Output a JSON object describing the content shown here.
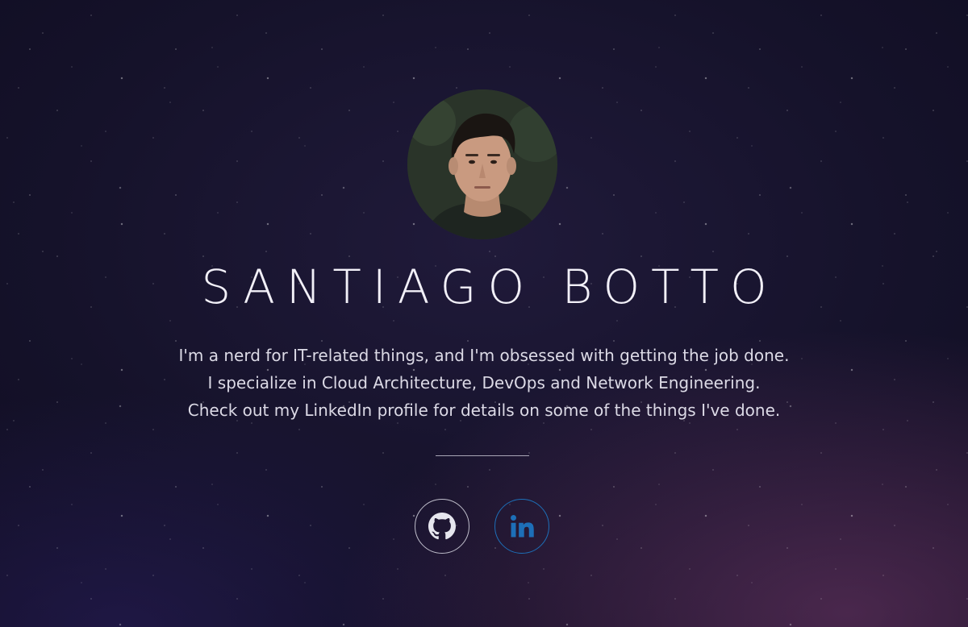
{
  "profile": {
    "name": "SANTIAGO BOTTO",
    "avatar_alt": "Profile photo"
  },
  "bio": {
    "lines": [
      "I'm a nerd for IT-related things, and I'm obsessed with getting the job done.",
      "I specialize in Cloud Architecture, DevOps and Network Engineering.",
      "Check out my LinkedIn profile for details on some of the things I've done."
    ]
  },
  "social": {
    "links": [
      {
        "icon": "github-icon",
        "label": "GitHub",
        "color": "#e6e6ee"
      },
      {
        "icon": "linkedin-icon",
        "label": "LinkedIn",
        "color": "#1d6fb8"
      }
    ]
  },
  "colors": {
    "background": "#15122a",
    "text": "#f2f0f8",
    "linkedin_accent": "#1d6fb8"
  }
}
